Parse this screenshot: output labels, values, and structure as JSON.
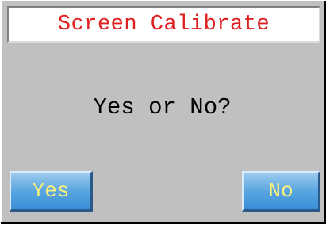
{
  "dialog": {
    "title": "Screen Calibrate",
    "question": "Yes or No?",
    "yes_label": "Yes",
    "no_label": "No"
  },
  "colors": {
    "background": "#c0c0c0",
    "title_text": "#e02020",
    "title_bg": "#ffffff",
    "button_bg": "#5aa6e0",
    "button_text": "#fbf27a"
  }
}
